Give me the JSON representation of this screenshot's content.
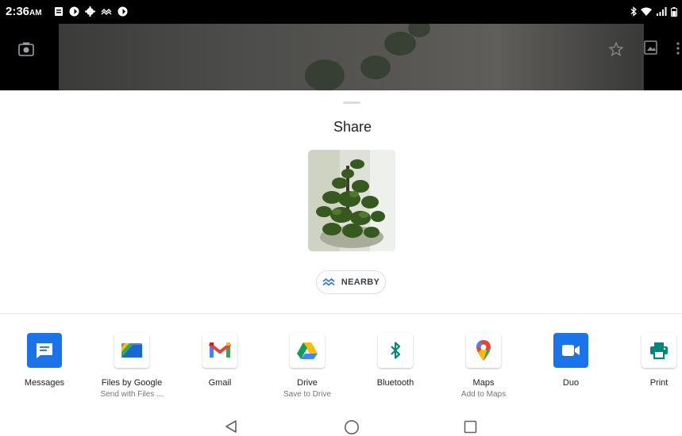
{
  "status_bar": {
    "time": "2:36",
    "ampm": "AM",
    "left_icons": [
      "notes-icon",
      "app-icon",
      "settings-icon",
      "nearby-share-icon",
      "app-icon"
    ],
    "right_icons": [
      "bluetooth-icon",
      "wifi-icon",
      "signal-icon",
      "battery-icon"
    ]
  },
  "camera": {
    "left_icon": "camera-icon",
    "right_icons": [
      "star-icon",
      "gallery-icon",
      "more-vert-icon"
    ]
  },
  "share_sheet": {
    "title": "Share",
    "preview_subject": "potted plant photo",
    "nearby_label": "NEARBY"
  },
  "apps": [
    {
      "label": "Messages",
      "sub": "",
      "icon": "messages-icon",
      "color": "#1a73e8"
    },
    {
      "label": "Files by Google",
      "sub": "Send with Files ...",
      "icon": "files-icon",
      "color": "#4285f4"
    },
    {
      "label": "Gmail",
      "sub": "",
      "icon": "gmail-icon",
      "color": "#ea4335"
    },
    {
      "label": "Drive",
      "sub": "Save to Drive",
      "icon": "drive-icon",
      "color": "#34a853"
    },
    {
      "label": "Bluetooth",
      "sub": "",
      "icon": "bluetooth-icon",
      "color": "#00897b"
    },
    {
      "label": "Maps",
      "sub": "Add to Maps",
      "icon": "maps-icon",
      "color": "#ea4335"
    },
    {
      "label": "Duo",
      "sub": "",
      "icon": "duo-icon",
      "color": "#1a73e8"
    },
    {
      "label": "Print",
      "sub": "",
      "icon": "print-icon",
      "color": "#00897b"
    }
  ],
  "nav_bar": [
    "back-icon",
    "home-icon",
    "recents-icon"
  ]
}
